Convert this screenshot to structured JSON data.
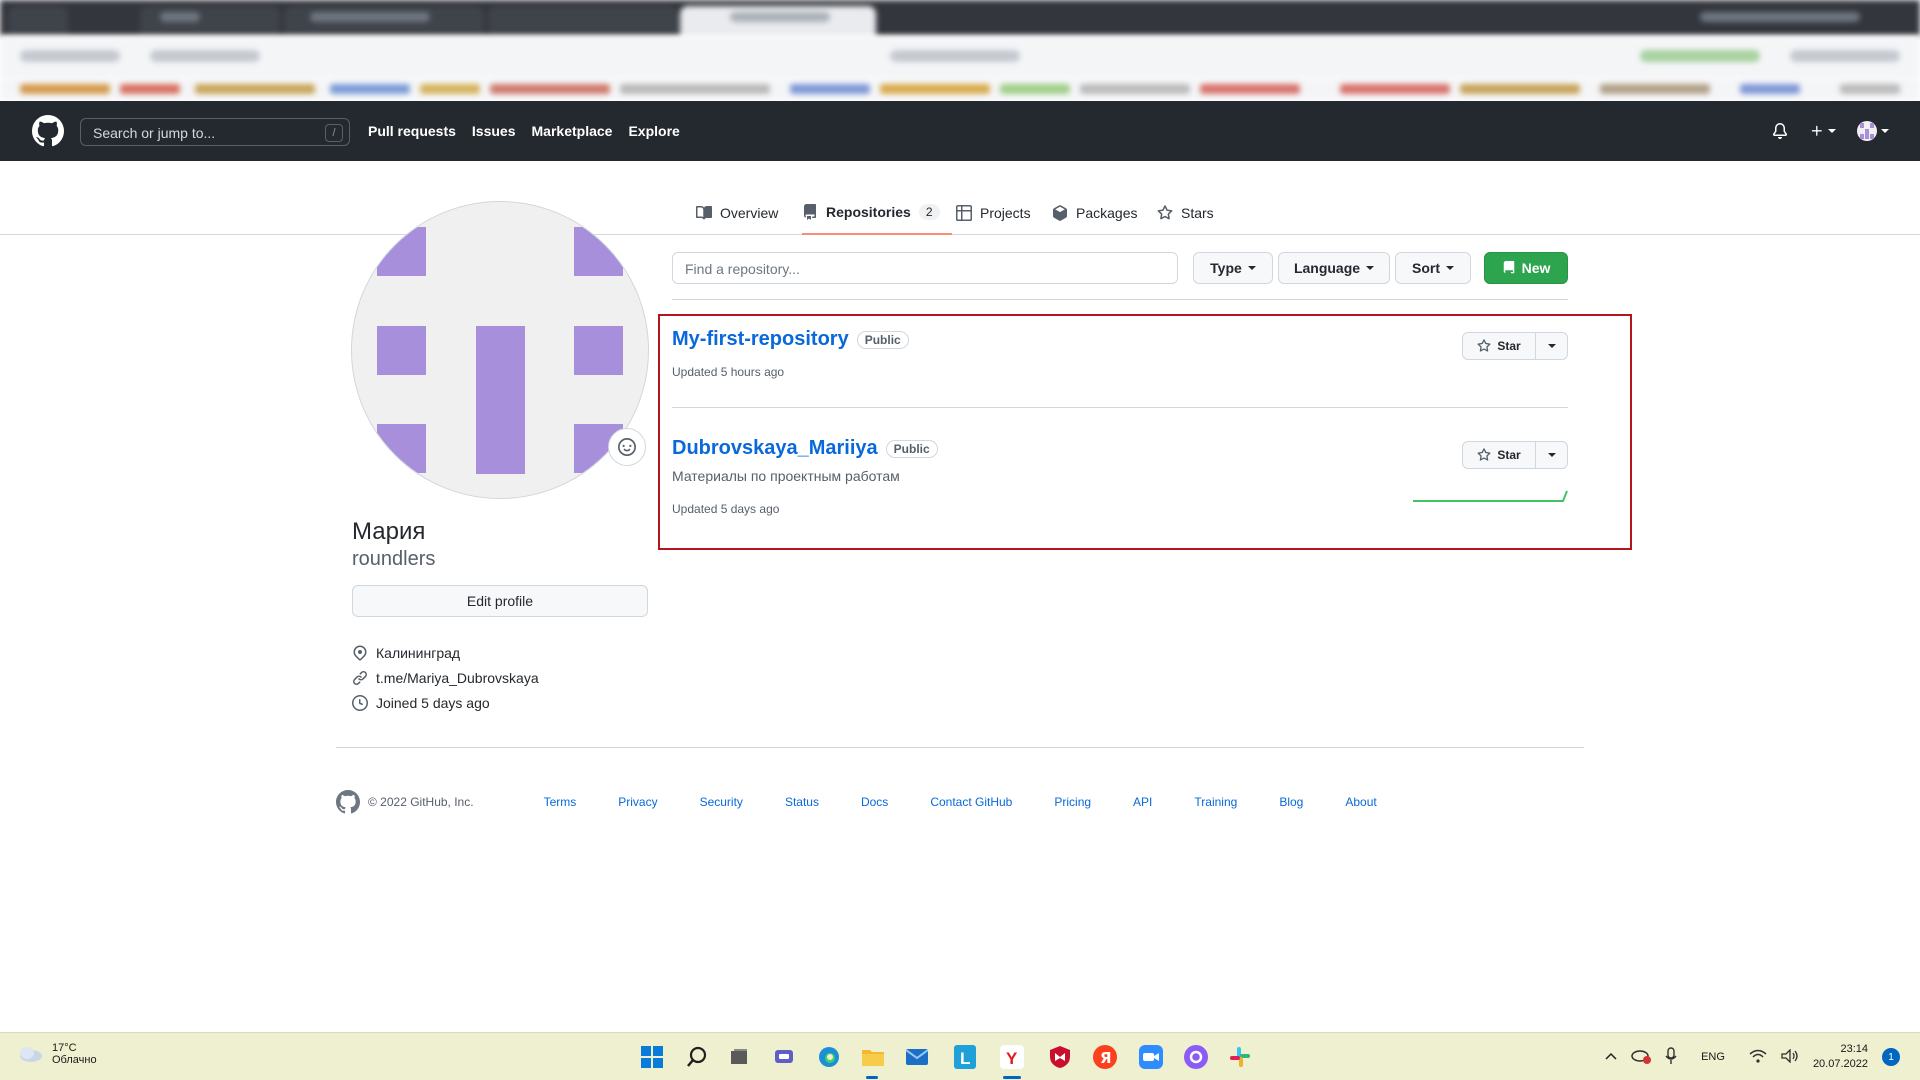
{
  "header": {
    "search_placeholder": "Search or jump to...",
    "search_shortcut": "/",
    "nav": [
      "Pull requests",
      "Issues",
      "Marketplace",
      "Explore"
    ]
  },
  "profile_tabs": [
    {
      "label": "Overview",
      "icon": "book-icon"
    },
    {
      "label": "Repositories",
      "icon": "repo-icon",
      "count": "2",
      "active": true
    },
    {
      "label": "Projects",
      "icon": "table-icon"
    },
    {
      "label": "Packages",
      "icon": "package-icon"
    },
    {
      "label": "Stars",
      "icon": "star-icon"
    }
  ],
  "profile": {
    "name": "Мария",
    "login": "roundlers",
    "edit_label": "Edit profile",
    "location": "Калининград",
    "link": "t.me/Mariya_Dubrovskaya",
    "joined": "Joined 5 days ago"
  },
  "filters": {
    "find_placeholder": "Find a repository...",
    "type_label": "Type",
    "language_label": "Language",
    "sort_label": "Sort",
    "new_label": "New"
  },
  "repos": [
    {
      "name": "My-first-repository",
      "visibility": "Public",
      "description": "",
      "updated": "Updated 5 hours ago",
      "star_label": "Star"
    },
    {
      "name": "Dubrovskaya_Mariiya",
      "visibility": "Public",
      "description": "Материалы по проектным работам",
      "updated": "Updated 5 days ago",
      "star_label": "Star"
    }
  ],
  "footer": {
    "copyright": "© 2022 GitHub, Inc.",
    "links": [
      "Terms",
      "Privacy",
      "Security",
      "Status",
      "Docs",
      "Contact GitHub",
      "Pricing",
      "API",
      "Training",
      "Blog",
      "About"
    ]
  },
  "taskbar": {
    "weather_temp": "17°C",
    "weather_desc": "Облачно",
    "language": "ENG",
    "time": "23:14",
    "date": "20.07.2022",
    "notifications": "1"
  },
  "colors": {
    "header_bg": "#24292f",
    "accent_link": "#0969da",
    "new_button": "#2da44e",
    "highlight_frame": "#b3151c",
    "avatar_purple": "#a88fdc",
    "taskbar_bg": "#eef0cf"
  }
}
